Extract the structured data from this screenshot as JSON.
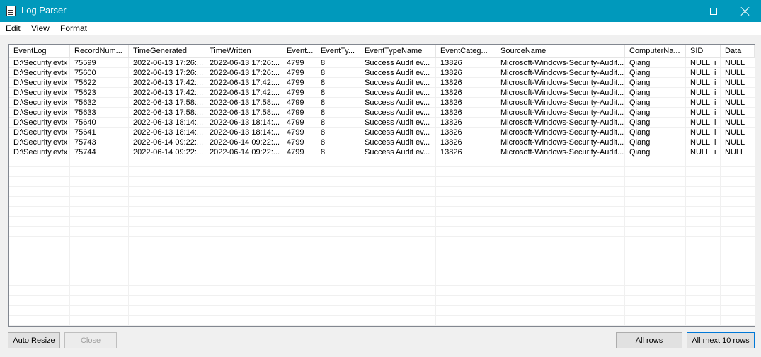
{
  "window": {
    "title": "Log Parser"
  },
  "menu": [
    "Edit",
    "View",
    "Format"
  ],
  "columns": [
    "EventLog",
    "RecordNum...",
    "TimeGenerated",
    "TimeWritten",
    "Event...",
    "EventTy...",
    "EventTypeName",
    "EventCateg...",
    "SourceName",
    "ComputerNa...",
    "SID",
    "",
    "Data"
  ],
  "rows": [
    [
      "D:\\Security.evtx",
      "75599",
      "2022-06-13 17:26:...",
      "2022-06-13 17:26:...",
      "4799",
      "8",
      "Success Audit ev...",
      "13826",
      "Microsoft-Windows-Security-Audit...",
      "Qiang",
      "NULL",
      "i",
      "NULL"
    ],
    [
      "D:\\Security.evtx",
      "75600",
      "2022-06-13 17:26:...",
      "2022-06-13 17:26:...",
      "4799",
      "8",
      "Success Audit ev...",
      "13826",
      "Microsoft-Windows-Security-Audit...",
      "Qiang",
      "NULL",
      "i",
      "NULL"
    ],
    [
      "D:\\Security.evtx",
      "75622",
      "2022-06-13 17:42:...",
      "2022-06-13 17:42:...",
      "4799",
      "8",
      "Success Audit ev...",
      "13826",
      "Microsoft-Windows-Security-Audit...",
      "Qiang",
      "NULL",
      "i",
      "NULL"
    ],
    [
      "D:\\Security.evtx",
      "75623",
      "2022-06-13 17:42:...",
      "2022-06-13 17:42:...",
      "4799",
      "8",
      "Success Audit ev...",
      "13826",
      "Microsoft-Windows-Security-Audit...",
      "Qiang",
      "NULL",
      "i",
      "NULL"
    ],
    [
      "D:\\Security.evtx",
      "75632",
      "2022-06-13 17:58:...",
      "2022-06-13 17:58:...",
      "4799",
      "8",
      "Success Audit ev...",
      "13826",
      "Microsoft-Windows-Security-Audit...",
      "Qiang",
      "NULL",
      "i",
      "NULL"
    ],
    [
      "D:\\Security.evtx",
      "75633",
      "2022-06-13 17:58:...",
      "2022-06-13 17:58:...",
      "4799",
      "8",
      "Success Audit ev...",
      "13826",
      "Microsoft-Windows-Security-Audit...",
      "Qiang",
      "NULL",
      "i",
      "NULL"
    ],
    [
      "D:\\Security.evtx",
      "75640",
      "2022-06-13 18:14:...",
      "2022-06-13 18:14:...",
      "4799",
      "8",
      "Success Audit ev...",
      "13826",
      "Microsoft-Windows-Security-Audit...",
      "Qiang",
      "NULL",
      "i",
      "NULL"
    ],
    [
      "D:\\Security.evtx",
      "75641",
      "2022-06-13 18:14:...",
      "2022-06-13 18:14:...",
      "4799",
      "8",
      "Success Audit ev...",
      "13826",
      "Microsoft-Windows-Security-Audit...",
      "Qiang",
      "NULL",
      "i",
      "NULL"
    ],
    [
      "D:\\Security.evtx",
      "75743",
      "2022-06-14 09:22:...",
      "2022-06-14 09:22:...",
      "4799",
      "8",
      "Success Audit ev...",
      "13826",
      "Microsoft-Windows-Security-Audit...",
      "Qiang",
      "NULL",
      "i",
      "NULL"
    ],
    [
      "D:\\Security.evtx",
      "75744",
      "2022-06-14 09:22:...",
      "2022-06-14 09:22:...",
      "4799",
      "8",
      "Success Audit ev...",
      "13826",
      "Microsoft-Windows-Security-Audit...",
      "Qiang",
      "NULL",
      "i",
      "NULL"
    ]
  ],
  "buttons": {
    "auto_resize": "Auto Resize",
    "close": "Close",
    "all_rows": "All rows",
    "next_rows": "All rnext 10 rows"
  },
  "colors": {
    "titlebar": "#0099bc",
    "focus_border": "#0078d7"
  }
}
